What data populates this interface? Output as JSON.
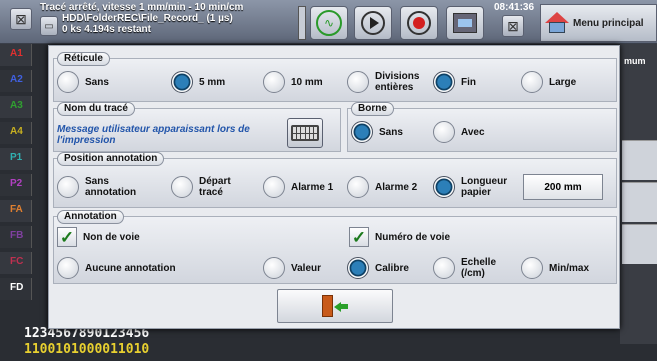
{
  "topbar": {
    "status_line1": "Tracé arrêté, vitesse 1 mm/min - 10 min/cm",
    "status_line2": "HDD\\FolderREC\\File_Record_ (1 µs)",
    "status_line3": "0 ks 4.194s restant",
    "clock": "08:41:36",
    "menu_label": "Menu principal"
  },
  "channels": [
    {
      "label": "A1",
      "color": "#e03030"
    },
    {
      "label": "A2",
      "color": "#4060e0"
    },
    {
      "label": "A3",
      "color": "#30a030"
    },
    {
      "label": "A4",
      "color": "#c8b020"
    },
    {
      "label": "P1",
      "color": "#30b0b0"
    },
    {
      "label": "P2",
      "color": "#b040c0"
    },
    {
      "label": "FA",
      "color": "#e08030"
    },
    {
      "label": "FB",
      "color": "#8040a0"
    },
    {
      "label": "FC",
      "color": "#c03050"
    },
    {
      "label": "FD",
      "color": "#ffffff"
    }
  ],
  "right_label": "mum",
  "bottom": {
    "digits_line1": "1234567890123456",
    "digits_line2": "1100101000011010"
  },
  "dialog": {
    "reticule": {
      "title": "Réticule",
      "options": [
        {
          "label": "Sans",
          "selected": false
        },
        {
          "label": "5 mm",
          "selected": true
        },
        {
          "label": "10 mm",
          "selected": false
        },
        {
          "label": "Divisions entières",
          "selected": false
        },
        {
          "label": "Fin",
          "selected": true
        },
        {
          "label": "Large",
          "selected": false
        }
      ]
    },
    "nom_trace": {
      "title": "Nom du tracé",
      "message": "Message utilisateur apparaissant lors de l'impression"
    },
    "borne": {
      "title": "Borne",
      "options": [
        {
          "label": "Sans",
          "selected": true
        },
        {
          "label": "Avec",
          "selected": false
        }
      ]
    },
    "position_annotation": {
      "title": "Position annotation",
      "options": [
        {
          "label": "Sans annotation",
          "selected": false
        },
        {
          "label": "Départ tracé",
          "selected": false
        },
        {
          "label": "Alarme 1",
          "selected": false
        },
        {
          "label": "Alarme 2",
          "selected": false
        },
        {
          "label": "Longueur papier",
          "selected": true
        }
      ],
      "length_value": "200 mm"
    },
    "annotation": {
      "title": "Annotation",
      "checks": [
        {
          "label": "Non de voie",
          "checked": true
        },
        {
          "label": "Numéro de voie",
          "checked": true
        }
      ],
      "options": [
        {
          "label": "Aucune annotation",
          "selected": false
        },
        {
          "label": "Valeur",
          "selected": false
        },
        {
          "label": "Calibre",
          "selected": true
        },
        {
          "label": "Echelle (/cm)",
          "selected": false
        },
        {
          "label": "Min/max",
          "selected": false
        }
      ]
    }
  }
}
